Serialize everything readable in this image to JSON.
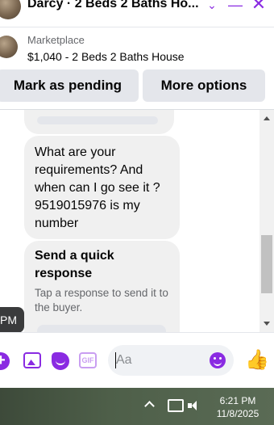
{
  "header": {
    "title": "Darcy · 2 Beds 2 Baths Ho...",
    "icons": [
      "chevron-down-icon",
      "minimize-icon",
      "close-icon"
    ]
  },
  "listing": {
    "source": "Marketplace",
    "title": "$1,040 - 2 Beds 2 Baths House"
  },
  "actions": {
    "mark_pending": "Mark as pending",
    "more_options": "More options"
  },
  "chat": {
    "message": "What are your requirements? And when can I go see it ? 9519015976 is my number",
    "quick_title": "Send a quick response",
    "quick_sub": "Tap a response to send it to the buyer."
  },
  "tooltip": {
    "time": "PM"
  },
  "composer": {
    "placeholder": "Aa",
    "icons": [
      "plus-icon",
      "photo-icon",
      "sticker-icon",
      "gif-icon",
      "emoji-icon",
      "thumbs-up-icon"
    ]
  },
  "taskbar": {
    "time": "6:21 PM",
    "date": "11/8/2025"
  },
  "colors": {
    "accent": "#8a2be2"
  }
}
